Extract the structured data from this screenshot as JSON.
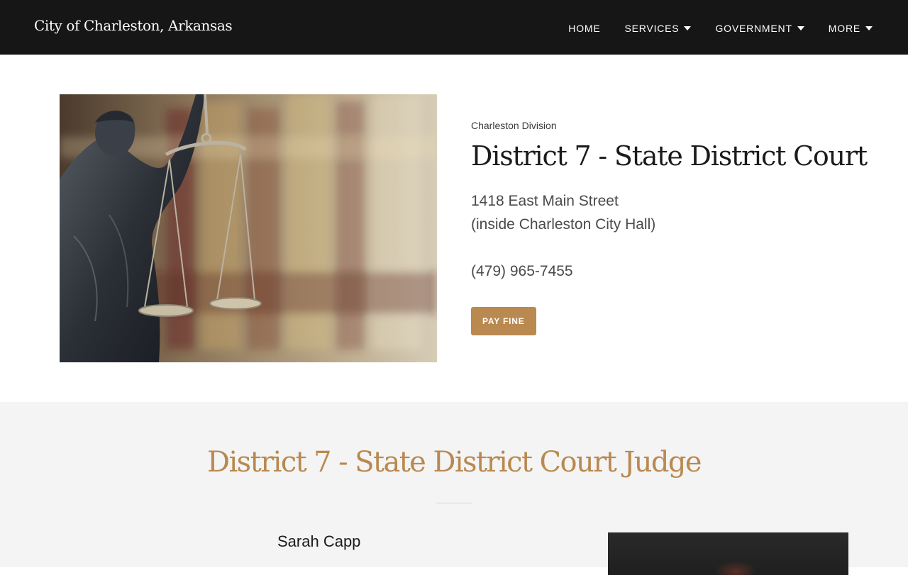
{
  "header": {
    "site_title": "City of Charleston, Arkansas",
    "nav": [
      {
        "label": "HOME",
        "has_dropdown": false
      },
      {
        "label": "SERVICES",
        "has_dropdown": true
      },
      {
        "label": "GOVERNMENT",
        "has_dropdown": true
      },
      {
        "label": "MORE",
        "has_dropdown": true
      }
    ]
  },
  "hero": {
    "image_alt": "Lady Justice statue holding scales in front of law books",
    "kicker": "Charleston Division",
    "title": "District 7 - State District Court",
    "address_line1": "1418 East Main Street",
    "address_line2": "(inside Charleston City Hall)",
    "phone": "(479) 965-7455",
    "button_label": "PAY FINE"
  },
  "judge": {
    "heading": "District 7 - State District Court Judge",
    "name": "Sarah Capp"
  },
  "colors": {
    "header_bg": "#161616",
    "accent": "#b98950",
    "section_bg": "#f4f4f4"
  }
}
